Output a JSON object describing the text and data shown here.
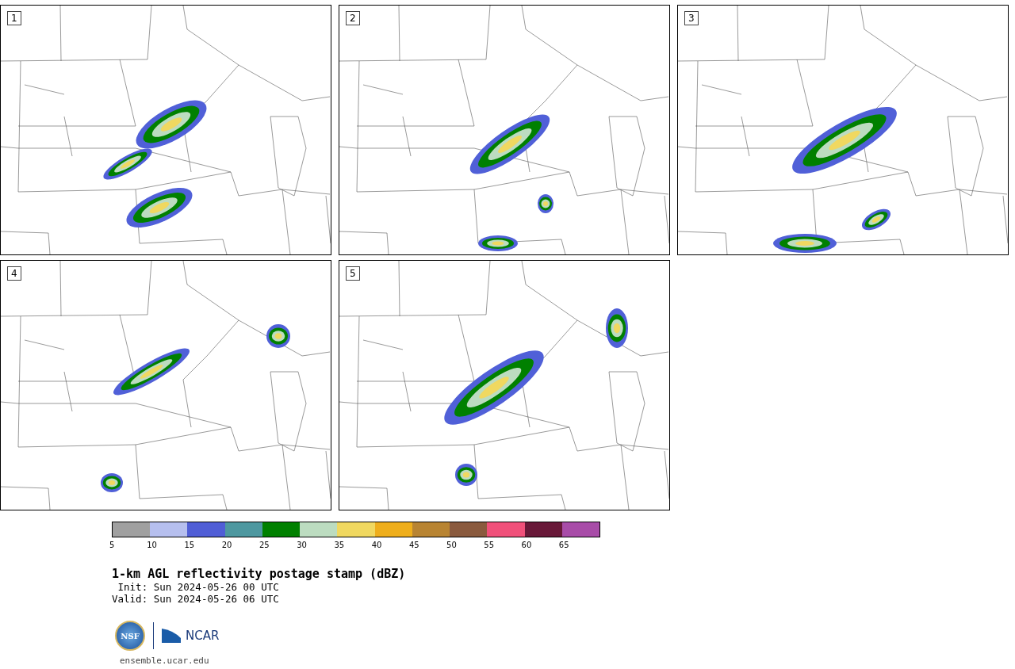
{
  "panels": [
    {
      "label": "1"
    },
    {
      "label": "2"
    },
    {
      "label": "3"
    },
    {
      "label": "4"
    },
    {
      "label": "5"
    }
  ],
  "colorbar": [
    {
      "tick": "5",
      "color": "#a0a0a0"
    },
    {
      "tick": "10",
      "color": "#b6bfee"
    },
    {
      "tick": "15",
      "color": "#505ed6"
    },
    {
      "tick": "20",
      "color": "#4e98a0"
    },
    {
      "tick": "25",
      "color": "#008000"
    },
    {
      "tick": "30",
      "color": "#bcdcc0"
    },
    {
      "tick": "35",
      "color": "#f0d860"
    },
    {
      "tick": "40",
      "color": "#eeae1c"
    },
    {
      "tick": "45",
      "color": "#b88432"
    },
    {
      "tick": "50",
      "color": "#8a5a3e"
    },
    {
      "tick": "55",
      "color": "#f0507a"
    },
    {
      "tick": "60",
      "color": "#681838"
    },
    {
      "tick": "65",
      "color": "#a84ca8"
    }
  ],
  "title": "1-km AGL reflectivity postage stamp (dBZ)",
  "init": " Init: Sun 2024-05-26 00 UTC",
  "valid": "Valid: Sun 2024-05-26 06 UTC",
  "logos": {
    "nsf": "NSF",
    "ncar": "NCAR"
  },
  "url": "ensemble.ucar.edu"
}
